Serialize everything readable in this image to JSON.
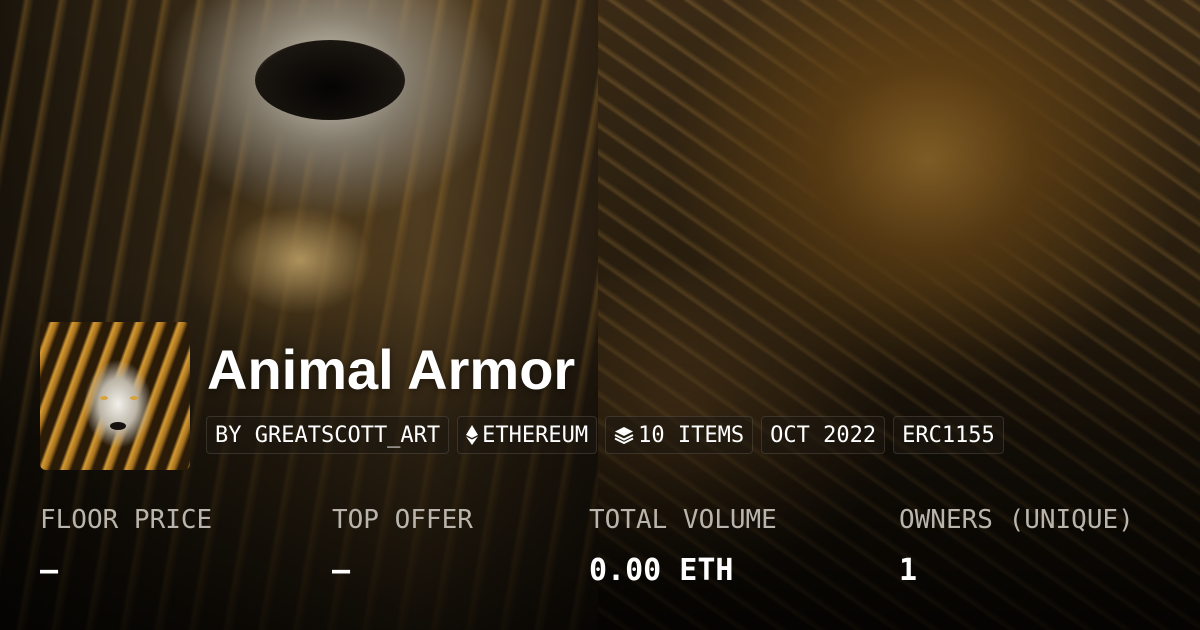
{
  "collection": {
    "title": "Animal Armor",
    "tags": {
      "creator": "BY GREATSCOTT_ART",
      "chain": "ETHEREUM",
      "chain_icon": "ethereum-icon",
      "items": "10 ITEMS",
      "items_icon": "layers-icon",
      "created": "OCT 2022",
      "standard": "ERC1155"
    }
  },
  "stats": {
    "floor_price": {
      "label": "FLOOR PRICE",
      "value": "–"
    },
    "top_offer": {
      "label": "TOP OFFER",
      "value": "–"
    },
    "total_volume": {
      "label": "TOTAL VOLUME",
      "value": "0.00 ETH"
    },
    "owners": {
      "label": "OWNERS (UNIQUE)",
      "value": "1"
    }
  },
  "colors": {
    "text": "#ffffff",
    "muted": "#b9b5ad",
    "accent_gold": "#d49a33"
  }
}
